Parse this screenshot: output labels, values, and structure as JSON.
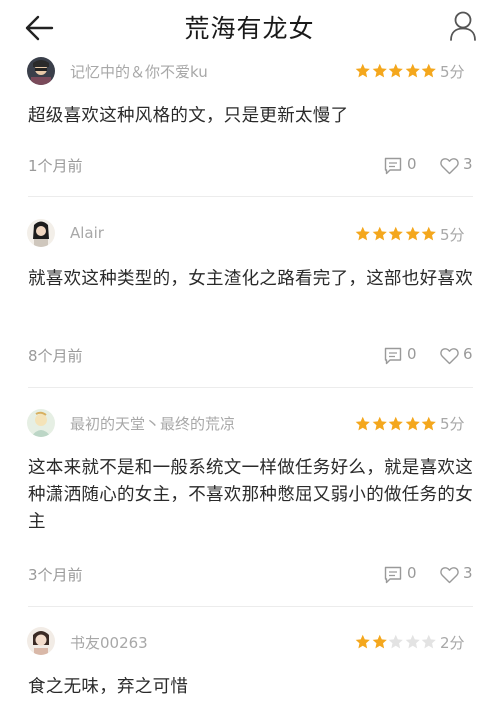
{
  "header": {
    "title": "荒海有龙女"
  },
  "colors": {
    "star_on": "#f4a71d",
    "star_off": "#e3e3e3"
  },
  "comments": [
    {
      "username": "记忆中的＆你不爱ku",
      "rating": 5,
      "score": "5分",
      "text": "超级喜欢这种风格的文，只是更新太慢了",
      "time": "1个月前",
      "replies": "0",
      "likes": "3"
    },
    {
      "username": "Alair",
      "rating": 5,
      "score": "5分",
      "text": "就喜欢这种类型的，女主渣化之路看完了，这部也好喜欢",
      "time": "8个月前",
      "replies": "0",
      "likes": "6"
    },
    {
      "username": "最初的天堂丶最终的荒凉",
      "rating": 5,
      "score": "5分",
      "text": "这本来就不是和一般系统文一样做任务好么，就是喜欢这种潇洒随心的女主，不喜欢那种憋屈又弱小的做任务的女主",
      "time": "3个月前",
      "replies": "0",
      "likes": "3"
    },
    {
      "username": "书友00263",
      "rating": 2,
      "score": "2分",
      "text": "食之无味，弃之可惜"
    }
  ]
}
